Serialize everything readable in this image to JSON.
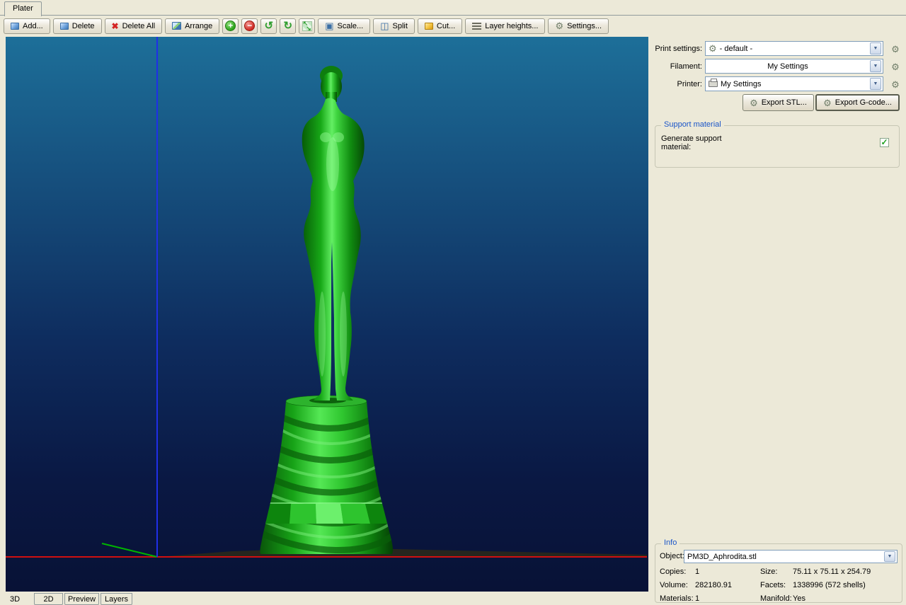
{
  "window": {
    "tab_label": "Plater"
  },
  "toolbar": {
    "add": "Add...",
    "delete": "Delete",
    "delete_all": "Delete All",
    "arrange": "Arrange",
    "scale": "Scale...",
    "split": "Split",
    "cut": "Cut...",
    "layer_heights": "Layer heights...",
    "settings": "Settings..."
  },
  "icons": {
    "gear": "⚙",
    "rotate_ccw": "↺",
    "rotate_cw": "↻",
    "plus": "+",
    "minus": "−",
    "cross": "✖",
    "dropdown_arrow": "▼",
    "check": "✓",
    "arrow_nw": "↖",
    "arrow_se": "↘",
    "scale_square": "▣",
    "split_square": "◫"
  },
  "sidebar": {
    "print_settings": {
      "label": "Print settings:",
      "value": "- default -"
    },
    "filament": {
      "label": "Filament:",
      "value": "My Settings"
    },
    "printer": {
      "label": "Printer:",
      "value": "My Settings"
    },
    "export_stl": "Export STL...",
    "export_gcode": "Export G-code...",
    "support": {
      "title": "Support material",
      "generate_label": "Generate support material:",
      "checked": true
    }
  },
  "info": {
    "title": "Info",
    "object_label": "Object:",
    "object_value": "PM3D_Aphrodita.stl",
    "copies_label": "Copies:",
    "copies": "1",
    "size_label": "Size:",
    "size": "75.11 x 75.11 x 254.79",
    "volume_label": "Volume:",
    "volume": "282180.91",
    "facets_label": "Facets:",
    "facets": "1338996 (572 shells)",
    "materials_label": "Materials:",
    "materials": "1",
    "manifold_label": "Manifold:",
    "manifold": "Yes"
  },
  "view_tabs": {
    "current": "3D",
    "tab_2d": "2D",
    "tab_preview": "Preview",
    "tab_layers": "Layers"
  },
  "colors": {
    "statue": "#2ec42e",
    "axis_x": "#d01010",
    "axis_y": "#00b400",
    "axis_z": "#1f2fe8",
    "group_title": "#1a55c8",
    "viewport_top": "#1d6f99",
    "viewport_bottom": "#081236"
  }
}
